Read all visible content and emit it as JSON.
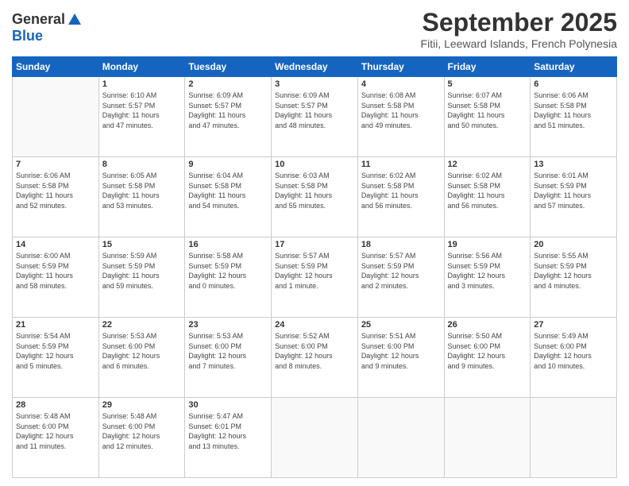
{
  "header": {
    "logo_line1": "General",
    "logo_line2": "Blue",
    "month": "September 2025",
    "location": "Fitii, Leeward Islands, French Polynesia"
  },
  "weekdays": [
    "Sunday",
    "Monday",
    "Tuesday",
    "Wednesday",
    "Thursday",
    "Friday",
    "Saturday"
  ],
  "weeks": [
    [
      {
        "day": "",
        "info": ""
      },
      {
        "day": "1",
        "info": "Sunrise: 6:10 AM\nSunset: 5:57 PM\nDaylight: 11 hours\nand 47 minutes."
      },
      {
        "day": "2",
        "info": "Sunrise: 6:09 AM\nSunset: 5:57 PM\nDaylight: 11 hours\nand 47 minutes."
      },
      {
        "day": "3",
        "info": "Sunrise: 6:09 AM\nSunset: 5:57 PM\nDaylight: 11 hours\nand 48 minutes."
      },
      {
        "day": "4",
        "info": "Sunrise: 6:08 AM\nSunset: 5:58 PM\nDaylight: 11 hours\nand 49 minutes."
      },
      {
        "day": "5",
        "info": "Sunrise: 6:07 AM\nSunset: 5:58 PM\nDaylight: 11 hours\nand 50 minutes."
      },
      {
        "day": "6",
        "info": "Sunrise: 6:06 AM\nSunset: 5:58 PM\nDaylight: 11 hours\nand 51 minutes."
      }
    ],
    [
      {
        "day": "7",
        "info": "Sunrise: 6:06 AM\nSunset: 5:58 PM\nDaylight: 11 hours\nand 52 minutes."
      },
      {
        "day": "8",
        "info": "Sunrise: 6:05 AM\nSunset: 5:58 PM\nDaylight: 11 hours\nand 53 minutes."
      },
      {
        "day": "9",
        "info": "Sunrise: 6:04 AM\nSunset: 5:58 PM\nDaylight: 11 hours\nand 54 minutes."
      },
      {
        "day": "10",
        "info": "Sunrise: 6:03 AM\nSunset: 5:58 PM\nDaylight: 11 hours\nand 55 minutes."
      },
      {
        "day": "11",
        "info": "Sunrise: 6:02 AM\nSunset: 5:58 PM\nDaylight: 11 hours\nand 56 minutes."
      },
      {
        "day": "12",
        "info": "Sunrise: 6:02 AM\nSunset: 5:58 PM\nDaylight: 11 hours\nand 56 minutes."
      },
      {
        "day": "13",
        "info": "Sunrise: 6:01 AM\nSunset: 5:59 PM\nDaylight: 11 hours\nand 57 minutes."
      }
    ],
    [
      {
        "day": "14",
        "info": "Sunrise: 6:00 AM\nSunset: 5:59 PM\nDaylight: 11 hours\nand 58 minutes."
      },
      {
        "day": "15",
        "info": "Sunrise: 5:59 AM\nSunset: 5:59 PM\nDaylight: 11 hours\nand 59 minutes."
      },
      {
        "day": "16",
        "info": "Sunrise: 5:58 AM\nSunset: 5:59 PM\nDaylight: 12 hours\nand 0 minutes."
      },
      {
        "day": "17",
        "info": "Sunrise: 5:57 AM\nSunset: 5:59 PM\nDaylight: 12 hours\nand 1 minute."
      },
      {
        "day": "18",
        "info": "Sunrise: 5:57 AM\nSunset: 5:59 PM\nDaylight: 12 hours\nand 2 minutes."
      },
      {
        "day": "19",
        "info": "Sunrise: 5:56 AM\nSunset: 5:59 PM\nDaylight: 12 hours\nand 3 minutes."
      },
      {
        "day": "20",
        "info": "Sunrise: 5:55 AM\nSunset: 5:59 PM\nDaylight: 12 hours\nand 4 minutes."
      }
    ],
    [
      {
        "day": "21",
        "info": "Sunrise: 5:54 AM\nSunset: 5:59 PM\nDaylight: 12 hours\nand 5 minutes."
      },
      {
        "day": "22",
        "info": "Sunrise: 5:53 AM\nSunset: 6:00 PM\nDaylight: 12 hours\nand 6 minutes."
      },
      {
        "day": "23",
        "info": "Sunrise: 5:53 AM\nSunset: 6:00 PM\nDaylight: 12 hours\nand 7 minutes."
      },
      {
        "day": "24",
        "info": "Sunrise: 5:52 AM\nSunset: 6:00 PM\nDaylight: 12 hours\nand 8 minutes."
      },
      {
        "day": "25",
        "info": "Sunrise: 5:51 AM\nSunset: 6:00 PM\nDaylight: 12 hours\nand 9 minutes."
      },
      {
        "day": "26",
        "info": "Sunrise: 5:50 AM\nSunset: 6:00 PM\nDaylight: 12 hours\nand 9 minutes."
      },
      {
        "day": "27",
        "info": "Sunrise: 5:49 AM\nSunset: 6:00 PM\nDaylight: 12 hours\nand 10 minutes."
      }
    ],
    [
      {
        "day": "28",
        "info": "Sunrise: 5:48 AM\nSunset: 6:00 PM\nDaylight: 12 hours\nand 11 minutes."
      },
      {
        "day": "29",
        "info": "Sunrise: 5:48 AM\nSunset: 6:00 PM\nDaylight: 12 hours\nand 12 minutes."
      },
      {
        "day": "30",
        "info": "Sunrise: 5:47 AM\nSunset: 6:01 PM\nDaylight: 12 hours\nand 13 minutes."
      },
      {
        "day": "",
        "info": ""
      },
      {
        "day": "",
        "info": ""
      },
      {
        "day": "",
        "info": ""
      },
      {
        "day": "",
        "info": ""
      }
    ]
  ]
}
